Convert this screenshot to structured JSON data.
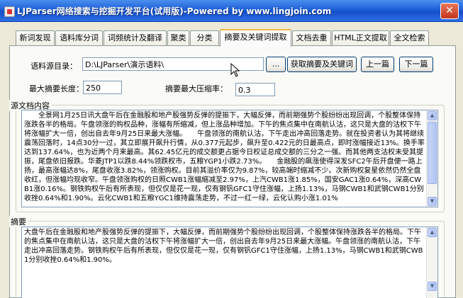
{
  "window": {
    "title": "LJParser网络搜索与挖掘开发平台(试用版)-Powered by www.lingjoin.com",
    "close_glyph": "✕"
  },
  "tabs": [
    {
      "label": "新词发现"
    },
    {
      "label": "语料库分词"
    },
    {
      "label": "词频统计及翻译"
    },
    {
      "label": "聚类"
    },
    {
      "label": "分类"
    },
    {
      "label": "摘要及关键词提取",
      "active": true
    },
    {
      "label": "文档去重"
    },
    {
      "label": "HTML正文提取"
    },
    {
      "label": "全文检索"
    }
  ],
  "form": {
    "source_dir_label": "语料源目录：",
    "source_dir_value": "D:\\LJParser\\演示语料\\",
    "browse_label": "...",
    "extract_label": "获取摘要及关键词",
    "prev_label": "上一篇",
    "next_label": "下一篇",
    "max_len_label": "最大摘要长度：",
    "max_len_value": "250",
    "max_ratio_label": "摘要最大压缩率：",
    "max_ratio_value": "0.3"
  },
  "source": {
    "label": "源文档内容",
    "text": "　　全景网1月25日讯大盘午后在金融股和地产股强势反弹的提振下，大幅反弹，而前期强势个股纷纷出现回调，个股整体保持涨跌各半的格局。午盘领涨的购权品种，涨幅有所缩减，但上涨品种增加。下午的焦点集中在南航认沽，这只是大盘的沽权下午将涨幅扩大一倍，创出自去年9月25日来最大涨幅。　　午盘领涨的南航认沽，下午走出冲高回落走势。就在投资者认为其将继续震荡回落时，14点30分一过，其立即展开飙升行情，从0.377元起步，飙升至0.422元的日最高点，即时涨幅接近13%。换手率达到137.64%，也为近两个月来最高。其62.45亿元的成交额更占据今日权证总成交额的三分之一强。而其他两支沽权未受其提振，尾盘依旧报跌。华菱JTP1以跌8.44%领跌权市，五粮YGP1小跌2.73%。　　金融股的飙涨使得深发SFC2午后开盘便一路上扬，最高涨幅达8%，尾盘收涨3.82%，领涨购权。目前其溢价率仅为9.87%，较高端时缩减不少。次新购权复星依然仍然全盘收红，但涨幅均现收窄。午盘领涨购权的日照CWB1涨幅缩减至2.97%，上汽CWB1涨1.85%，国安GAC1涨0.64%，深高CWB1涨0.16%。钢铁购权午后有所表现，但仅仅是花一现，仅有钢钒GFC1守住涨幅，上扬1.13%，马钢CWB1和武钢CWB1分别收挫0.64%和1.90%。云化CWB1和五粮YGC1维持震荡走势，不过一红一绿，云化认购小涨1.01%"
  },
  "summary": {
    "label": "摘要",
    "text": "大盘午后在金融股和地产股强势反弹的提振下，大幅反弹，而前期强势个股纷纷出现回调，个股整体保持涨跌各半的格局。下午的焦点集中在南航认沽，这只是大盘的沽权下午将涨幅扩大一倍，创出自去年9月25日来最大涨幅。午盘领涨的南航认沽，下午走出冲高回落走势。钢铁购权午后有所表现，但仅仅是花一现，仅有钢钒GFC1守住涨幅，上扬1.13%，马钢CWB1和武钢CWB1分别收挫0.64%和1.90%。"
  }
}
